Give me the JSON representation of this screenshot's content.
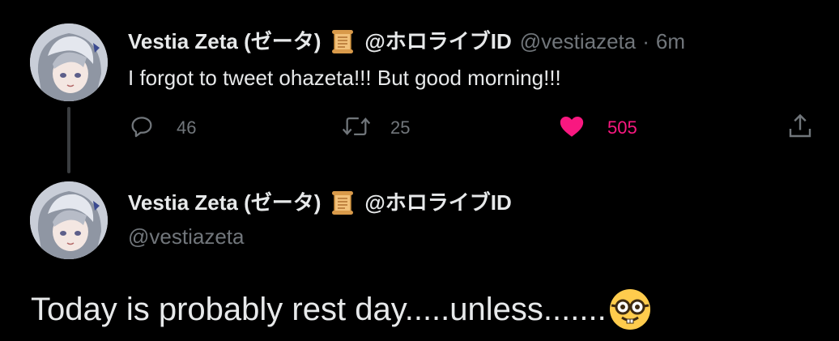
{
  "colors": {
    "background": "#000000",
    "primary_text": "#e7e9ea",
    "secondary_text": "#71767b",
    "like_pink": "#f91880",
    "thread_line": "#3a3d40"
  },
  "tweet1": {
    "display_name": "Vestia Zeta (ゼータ)",
    "name_emoji": "scroll-emoji",
    "org_handle": "@ホロライブID",
    "handle": "@vestiazeta",
    "separator": "·",
    "time": "6m",
    "text": "I forgot to tweet ohazeta!!! But good morning!!!",
    "actions": {
      "reply_icon": "reply-icon",
      "reply_count": "46",
      "retweet_icon": "retweet-icon",
      "retweet_count": "25",
      "like_icon": "heart-filled-icon",
      "like_count": "505",
      "share_icon": "share-icon"
    }
  },
  "tweet2": {
    "display_name": "Vestia Zeta (ゼータ)",
    "name_emoji": "scroll-emoji",
    "org_handle": "@ホロライブID",
    "handle": "@vestiazeta",
    "text": "Today is probably rest day.....unless.......",
    "trailing_emoji": "nerd-face-emoji"
  }
}
